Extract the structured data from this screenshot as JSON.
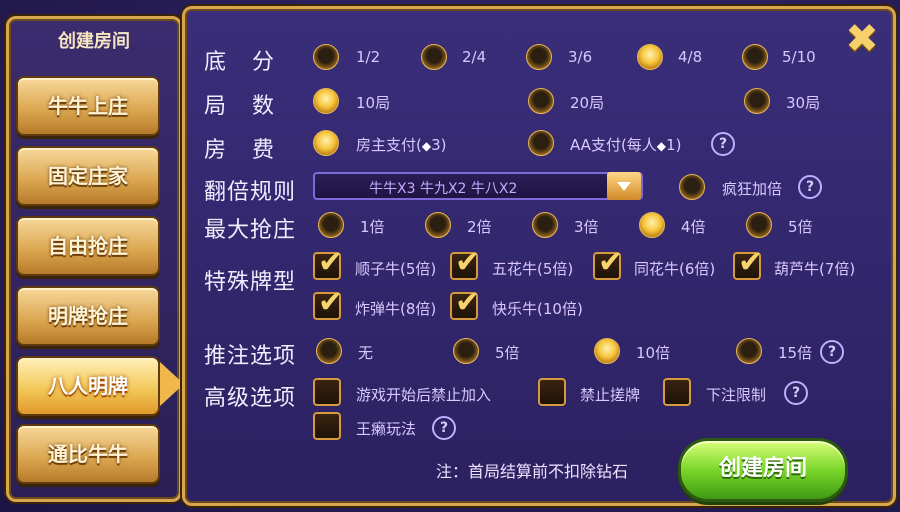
{
  "left_panel": {
    "title": "创建房间",
    "modes": [
      {
        "label": "牛牛上庄"
      },
      {
        "label": "固定庄家"
      },
      {
        "label": "自由抢庄"
      },
      {
        "label": "明牌抢庄"
      },
      {
        "label": "八人明牌",
        "selected": true
      },
      {
        "label": "通比牛牛"
      }
    ]
  },
  "settings": {
    "base_score": {
      "label": "底分",
      "options": [
        "1/2",
        "2/4",
        "3/6",
        "4/8",
        "5/10"
      ],
      "selected": "4/8"
    },
    "rounds": {
      "label": "局数",
      "options": [
        "10局",
        "20局",
        "30局"
      ],
      "selected": "10局"
    },
    "room_fee": {
      "label": "房费",
      "options": [
        {
          "prefix": "房主支付(",
          "diamond": "◆",
          "suffix": "3)"
        },
        {
          "prefix": "AA支付(每人",
          "diamond": "◆",
          "suffix": "1)"
        }
      ],
      "selected_index": 0
    },
    "double_rule": {
      "label": "翻倍规则",
      "value": "牛牛X3  牛九X2  牛八X2",
      "crazy_label": "疯狂加倍",
      "crazy_selected": false
    },
    "max_grab": {
      "label": "最大抢庄",
      "options": [
        "1倍",
        "2倍",
        "3倍",
        "4倍",
        "5倍"
      ],
      "selected": "4倍"
    },
    "special_cards": {
      "label": "特殊牌型",
      "items": [
        {
          "label": "顺子牛(5倍)",
          "checked": true
        },
        {
          "label": "五花牛(5倍)",
          "checked": true
        },
        {
          "label": "同花牛(6倍)",
          "checked": true
        },
        {
          "label": "葫芦牛(7倍)",
          "checked": true
        },
        {
          "label": "炸弹牛(8倍)",
          "checked": true
        },
        {
          "label": "快乐牛(10倍)",
          "checked": true
        }
      ]
    },
    "push_bet": {
      "label": "推注选项",
      "options": [
        "无",
        "5倍",
        "10倍",
        "15倍"
      ],
      "selected": "10倍"
    },
    "advanced": {
      "label": "高级选项",
      "items": [
        {
          "label": "游戏开始后禁止加入",
          "checked": false
        },
        {
          "label": "禁止搓牌",
          "checked": false
        },
        {
          "label": "下注限制",
          "checked": false
        },
        {
          "label": "王癞玩法",
          "checked": false
        }
      ]
    }
  },
  "help_glyph": "?",
  "tick_glyph": "✔",
  "close_glyph": "✖",
  "footer": {
    "note": "注：首局结算前不扣除钻石",
    "create_label": "创建房间"
  },
  "colors": {
    "accent_gold": "#f6c53c",
    "button_green": "#7ad62a",
    "panel_purple": "#2b2160"
  }
}
